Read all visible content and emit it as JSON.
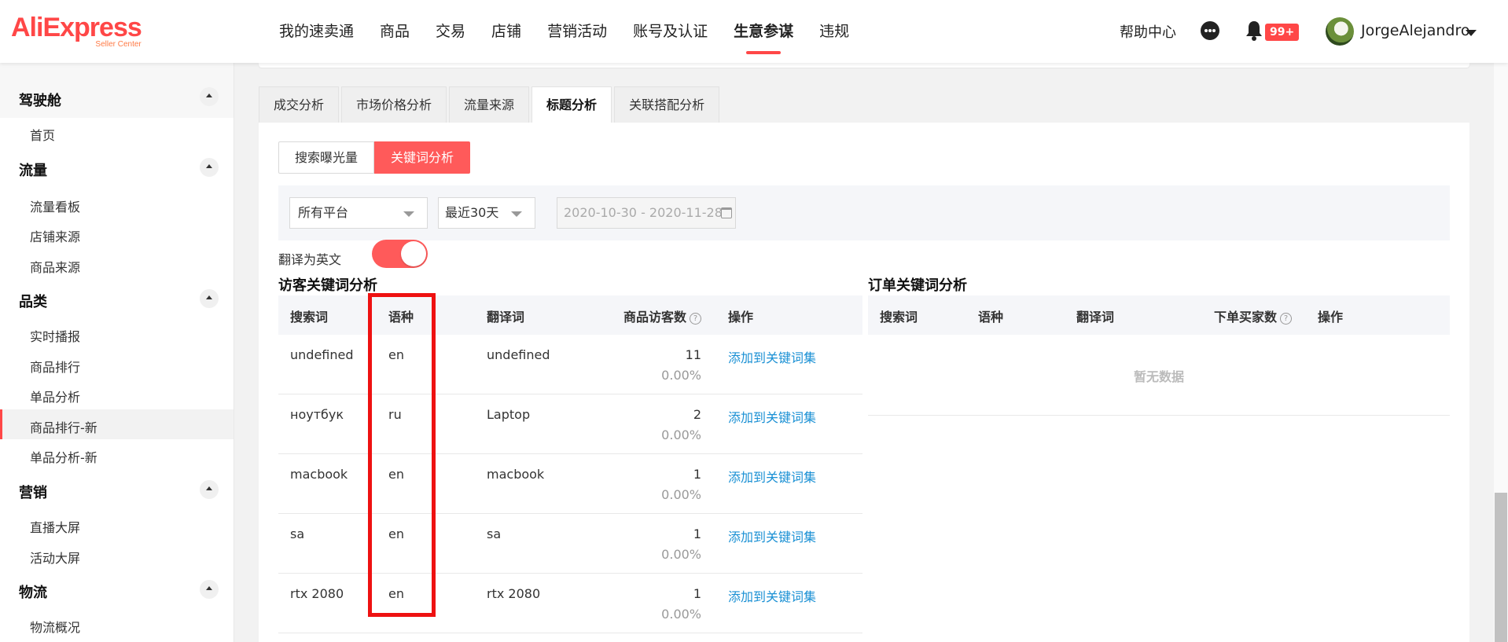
{
  "logo": {
    "main": "AliExpress",
    "sub": "Seller Center"
  },
  "nav": [
    {
      "label": "我的速卖通"
    },
    {
      "label": "商品"
    },
    {
      "label": "交易"
    },
    {
      "label": "店铺"
    },
    {
      "label": "营销活动"
    },
    {
      "label": "账号及认证"
    },
    {
      "label": "生意参谋",
      "active": true
    },
    {
      "label": "违规"
    }
  ],
  "header": {
    "help": "帮助中心",
    "badge": "99+",
    "username": "JorgeAlejandro"
  },
  "sidebar": {
    "groups": [
      {
        "title": "驾驶舱",
        "items": [
          "首页"
        ]
      },
      {
        "title": "流量",
        "items": [
          "流量看板",
          "店铺来源",
          "商品来源"
        ]
      },
      {
        "title": "品类",
        "items": [
          "实时播报",
          "商品排行",
          "单品分析",
          "商品排行-新",
          "单品分析-新"
        ]
      },
      {
        "title": "营销",
        "items": [
          "直播大屏",
          "活动大屏"
        ]
      },
      {
        "title": "物流",
        "items": [
          "物流概况"
        ]
      }
    ],
    "active_item": "商品排行-新"
  },
  "tabs": [
    "成交分析",
    "市场价格分析",
    "流量来源",
    "标题分析",
    "关联搭配分析"
  ],
  "active_tab": "标题分析",
  "subtabs": [
    "搜索曝光量",
    "关键词分析"
  ],
  "active_subtab": "关键词分析",
  "filters": {
    "platform": "所有平台",
    "period": "最近30天",
    "date_range": "2020-10-30 - 2020-11-28"
  },
  "translate": {
    "label": "翻译为英文",
    "enabled": true
  },
  "visitor_table": {
    "title": "访客关键词分析",
    "columns": [
      "搜索词",
      "语种",
      "翻译词",
      "商品访客数",
      "操作"
    ],
    "rows": [
      {
        "term": "undefined",
        "lang": "en",
        "translation": "undefined",
        "visitors": "11",
        "pct": "0.00%",
        "action": "添加到关键词集"
      },
      {
        "term": "ноутбук",
        "lang": "ru",
        "translation": "Laptop",
        "visitors": "2",
        "pct": "0.00%",
        "action": "添加到关键词集"
      },
      {
        "term": "macbook",
        "lang": "en",
        "translation": "macbook",
        "visitors": "1",
        "pct": "0.00%",
        "action": "添加到关键词集"
      },
      {
        "term": "sa",
        "lang": "en",
        "translation": "sa",
        "visitors": "1",
        "pct": "0.00%",
        "action": "添加到关键词集"
      },
      {
        "term": "rtx 2080",
        "lang": "en",
        "translation": "rtx 2080",
        "visitors": "1",
        "pct": "0.00%",
        "action": "添加到关键词集"
      }
    ]
  },
  "order_table": {
    "title": "订单关键词分析",
    "columns": [
      "搜索词",
      "语种",
      "翻译词",
      "下单买家数",
      "操作"
    ],
    "empty_text": "暂无数据"
  },
  "colors": {
    "accent": "#ff4747",
    "link": "#1a90d4",
    "highlight": "#ee1111"
  }
}
